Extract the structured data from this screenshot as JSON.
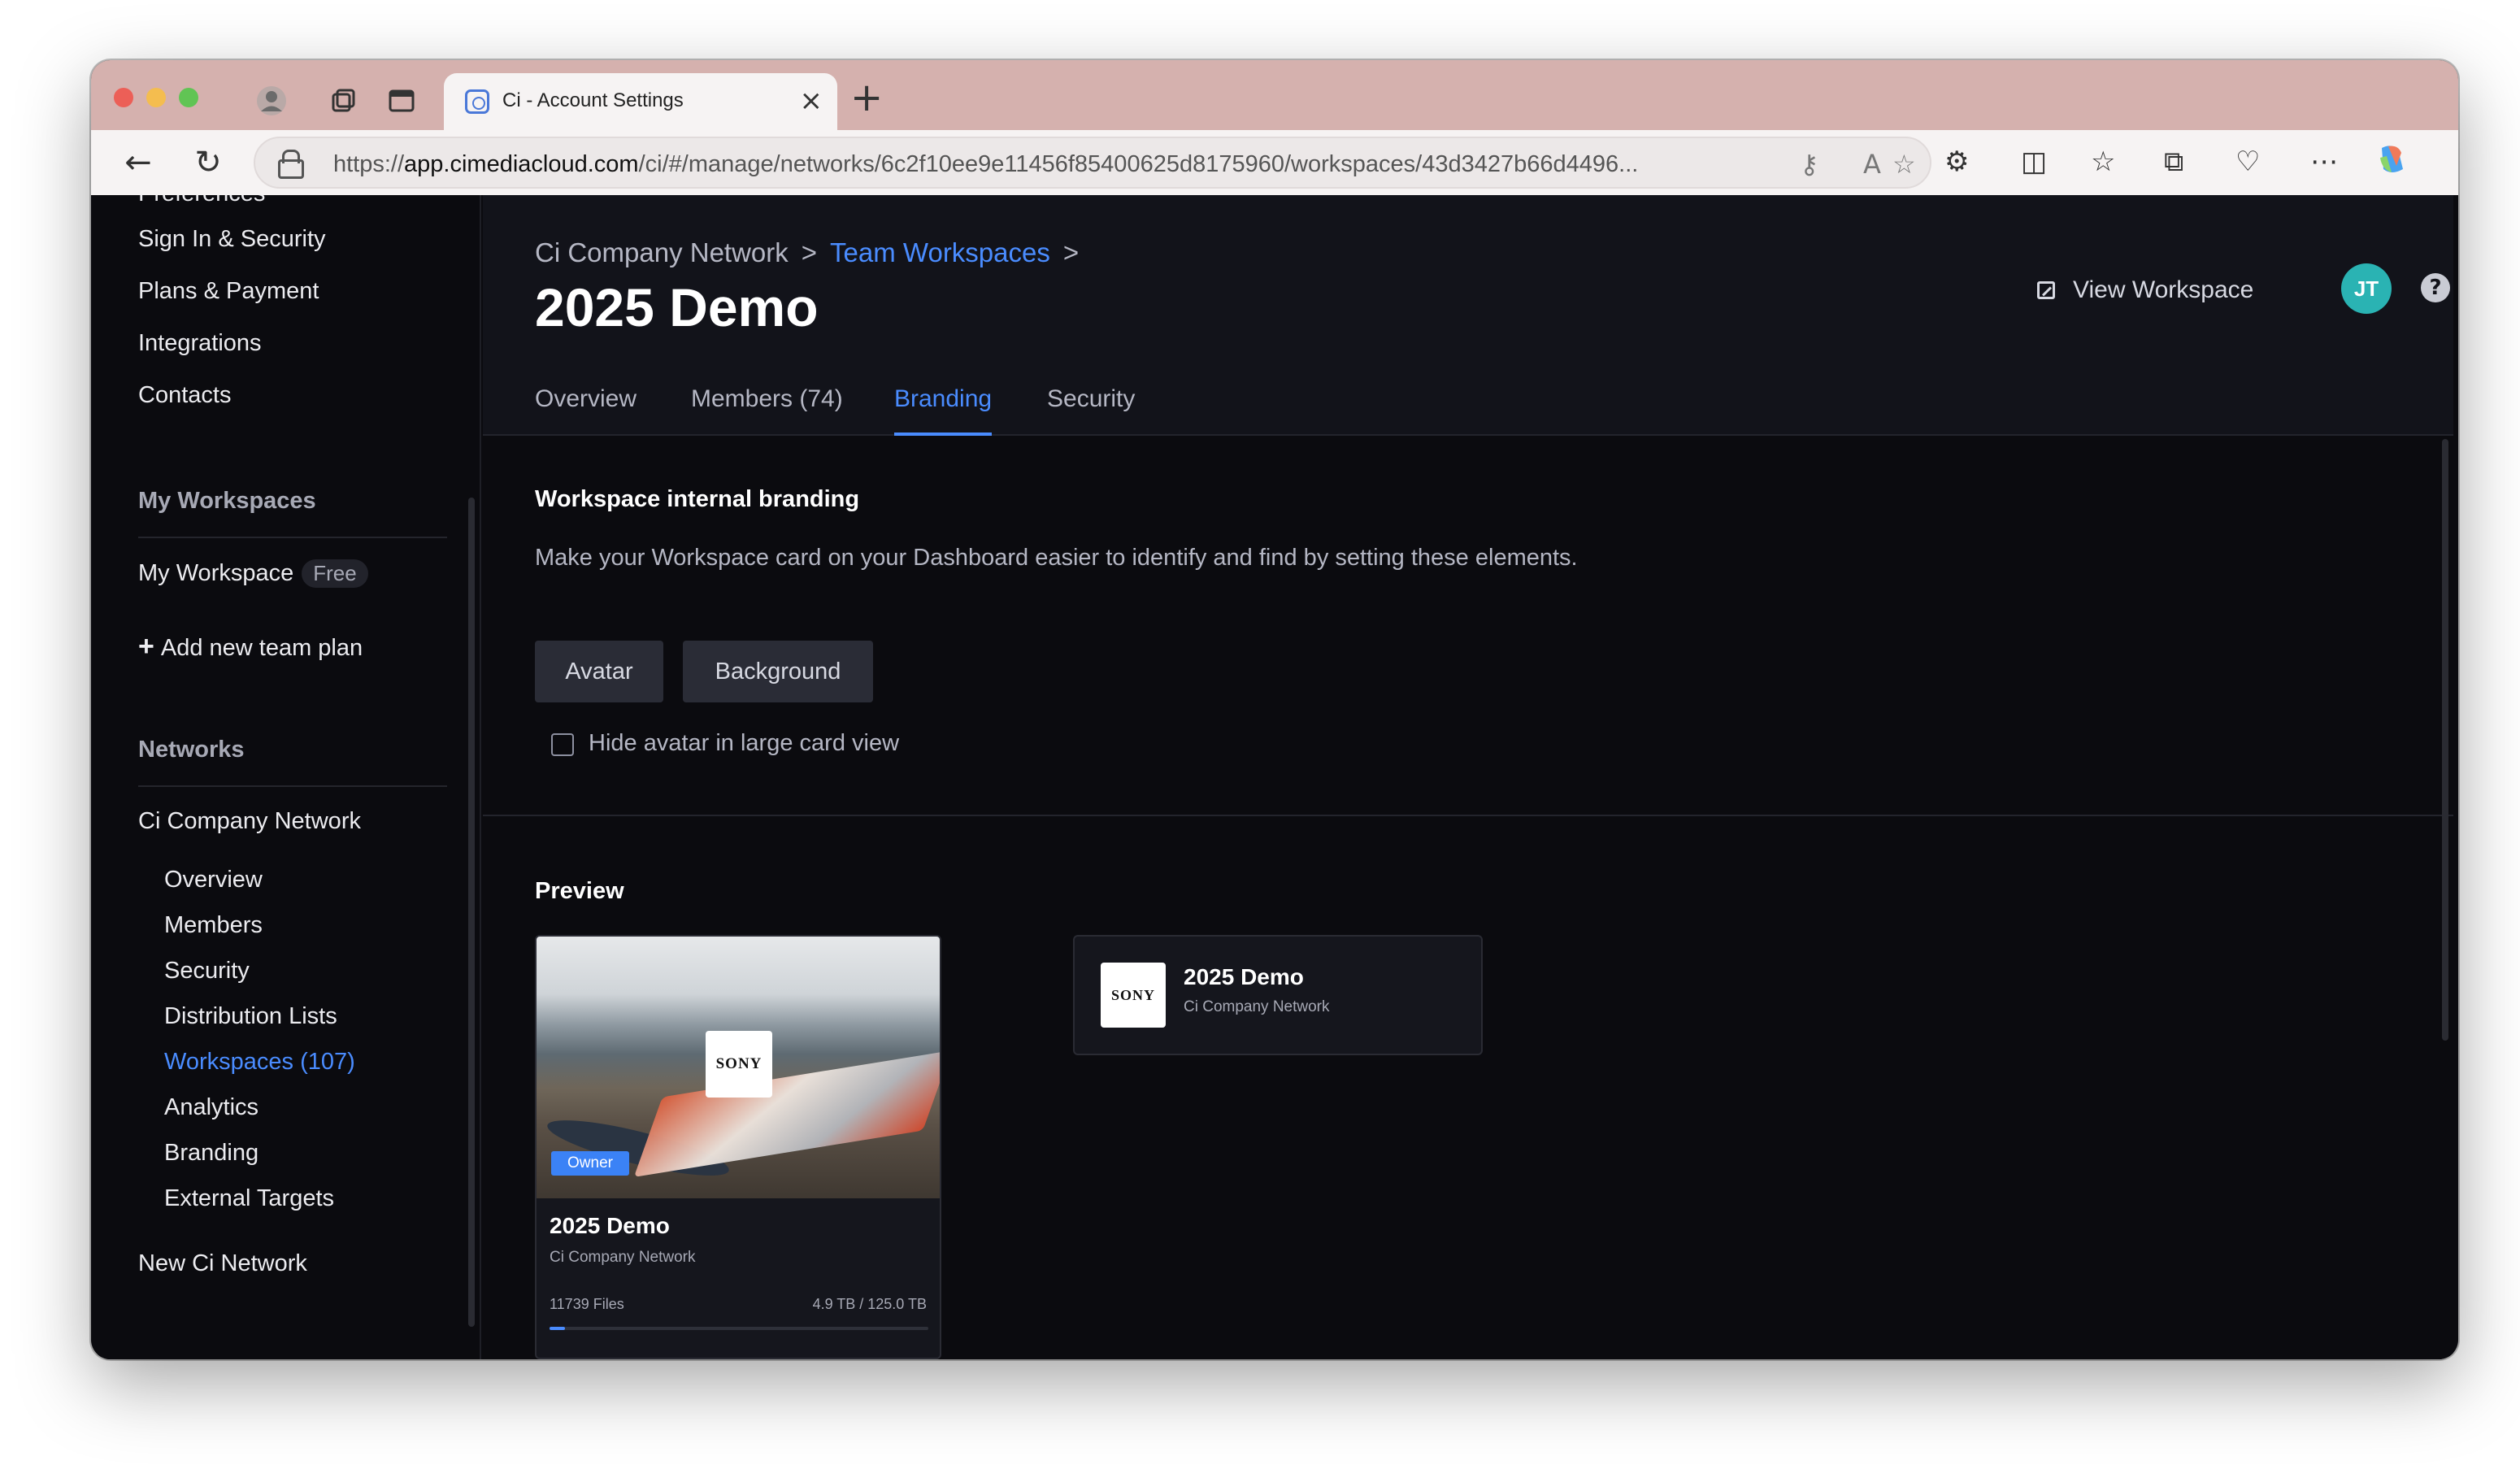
{
  "browser": {
    "tab_title": "Ci - Account Settings",
    "url_prefix": "https://",
    "url_host": "app.cimediacloud.com",
    "url_path": "/ci/#/manage/networks/6c2f10ee9e11456f85400625d8175960/workspaces/43d3427b66d4496..."
  },
  "sidebar": {
    "partial_top": "Preferences",
    "account_items": [
      "Sign In & Security",
      "Plans & Payment",
      "Integrations",
      "Contacts"
    ],
    "my_workspaces_heading": "My Workspaces",
    "my_workspace_label": "My Workspace",
    "my_workspace_badge": "Free",
    "add_team_plan": "Add new team plan",
    "networks_heading": "Networks",
    "network_name": "Ci Company Network",
    "network_items": [
      "Overview",
      "Members",
      "Security",
      "Distribution Lists",
      "Workspaces (107)",
      "Analytics",
      "Branding",
      "External Targets"
    ],
    "new_network": "New Ci Network"
  },
  "header": {
    "crumb_network": "Ci Company Network",
    "crumb_sep": ">",
    "crumb_workspaces": "Team Workspaces",
    "title": "2025 Demo",
    "view_workspace": "View Workspace",
    "avatar_initials": "JT",
    "help": "?"
  },
  "tabs": [
    "Overview",
    "Members (74)",
    "Branding",
    "Security"
  ],
  "branding": {
    "heading": "Workspace internal branding",
    "description": "Make your Workspace card on your Dashboard easier to identify and find by setting these elements.",
    "avatar_button": "Avatar",
    "background_button": "Background",
    "hide_avatar_label": "Hide avatar in large card view",
    "hide_avatar_checked": false
  },
  "preview": {
    "heading": "Preview",
    "logo_text": "SONY",
    "owner_badge": "Owner",
    "title": "2025 Demo",
    "network": "Ci Company Network",
    "files": "11739 Files",
    "storage": "4.9 TB / 125.0 TB",
    "storage_fraction": 0.04
  },
  "colors": {
    "accent": "#4a8cff",
    "avatar": "#2ab3b3",
    "owner_badge": "#3b82f6"
  }
}
